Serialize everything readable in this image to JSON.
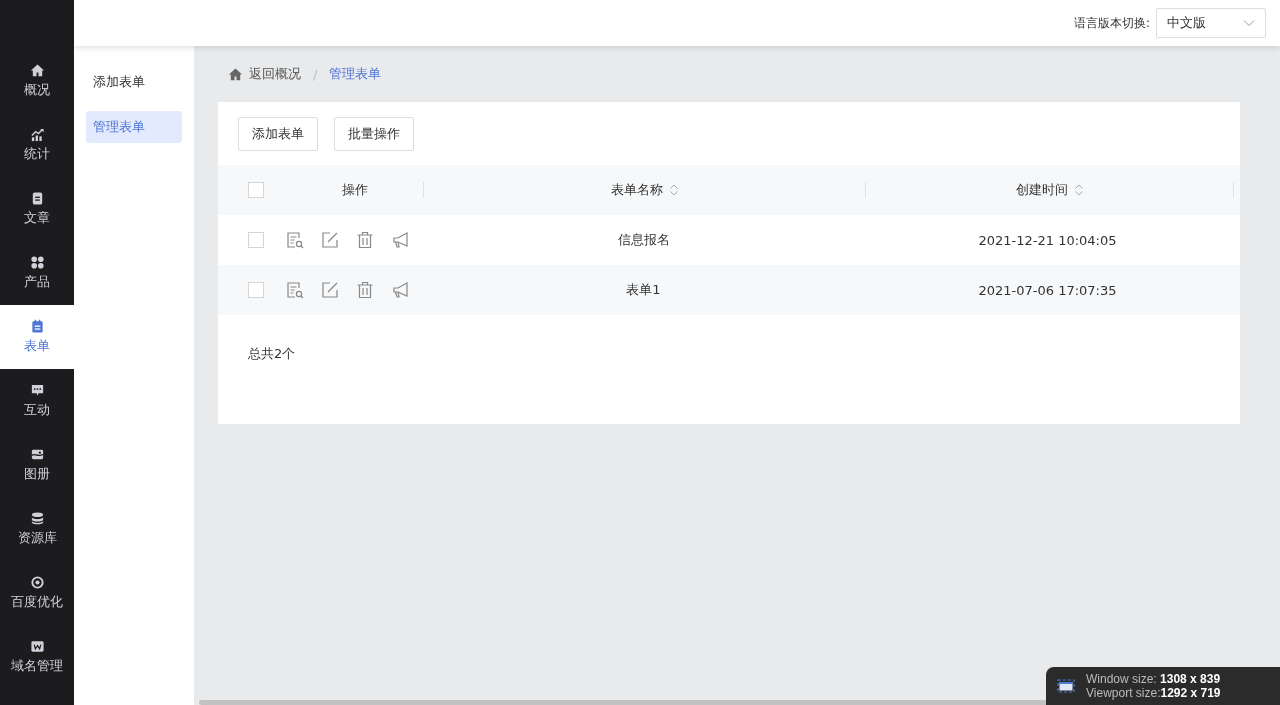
{
  "nav": [
    {
      "label": "概况",
      "kind": "home",
      "selected": false
    },
    {
      "label": "统计",
      "kind": "chart",
      "selected": false
    },
    {
      "label": "文章",
      "kind": "doc",
      "selected": false
    },
    {
      "label": "产品",
      "kind": "grid",
      "selected": false
    },
    {
      "label": "表单",
      "kind": "form",
      "selected": true
    },
    {
      "label": "互动",
      "kind": "chat",
      "selected": false
    },
    {
      "label": "图册",
      "kind": "album",
      "selected": false
    },
    {
      "label": "资源库",
      "kind": "db",
      "selected": false
    },
    {
      "label": "百度优化",
      "kind": "seo",
      "selected": false
    },
    {
      "label": "域名管理",
      "kind": "w",
      "selected": false
    }
  ],
  "subnav": [
    {
      "label": "添加表单",
      "selected": false
    },
    {
      "label": "管理表单",
      "selected": true
    }
  ],
  "header": {
    "language_label": "语言版本切换:",
    "language_value": "中文版"
  },
  "breadcrumb": {
    "home": "返回概况",
    "separator": "/",
    "current": "管理表单"
  },
  "toolbar": [
    "添加表单",
    "批量操作"
  ],
  "table": {
    "select_all_checked": false,
    "columns": [
      {
        "label": "操作",
        "sortable": false
      },
      {
        "label": "表单名称",
        "sortable": true
      },
      {
        "label": "创建时间",
        "sortable": true
      }
    ],
    "rows": [
      {
        "checked": false,
        "name": "信息报名",
        "created": "2021-12-21 10:04:05"
      },
      {
        "checked": false,
        "name": "表单1",
        "created": "2021-07-06 17:07:35"
      }
    ]
  },
  "total": "总共2个",
  "size_overlay": {
    "window_label": "Window size:",
    "window_value": "1308 x 839",
    "viewport_label": "Viewport size:",
    "viewport_value": "1292 x 719"
  }
}
